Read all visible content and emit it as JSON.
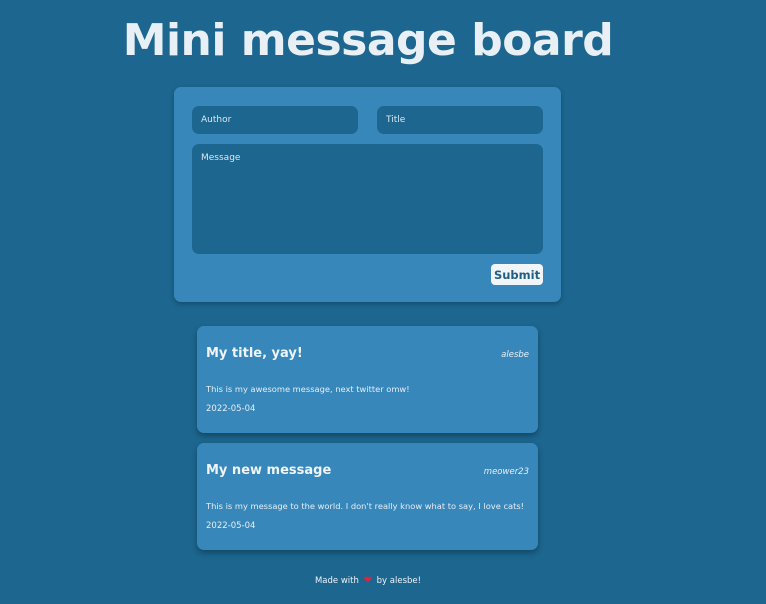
{
  "page": {
    "title": "Mini message board"
  },
  "form": {
    "author_placeholder": "Author",
    "title_placeholder": "Title",
    "message_placeholder": "Message",
    "submit_label": "Submit"
  },
  "messages": [
    {
      "title": "My title, yay!",
      "author": "alesbe",
      "body": "This is my awesome message, next twitter omw!",
      "date": "2022-05-04"
    },
    {
      "title": "My new message",
      "author": "meower23",
      "body": "This is my message to the world. I don't really know what to say, I love cats!",
      "date": "2022-05-04"
    }
  ],
  "footer": {
    "prefix": "Made with",
    "heart_icon": "heart-icon",
    "suffix": "by alesbe!"
  },
  "colors": {
    "background": "#1c668f",
    "card": "#3887ba",
    "heart": "#e0243c"
  }
}
